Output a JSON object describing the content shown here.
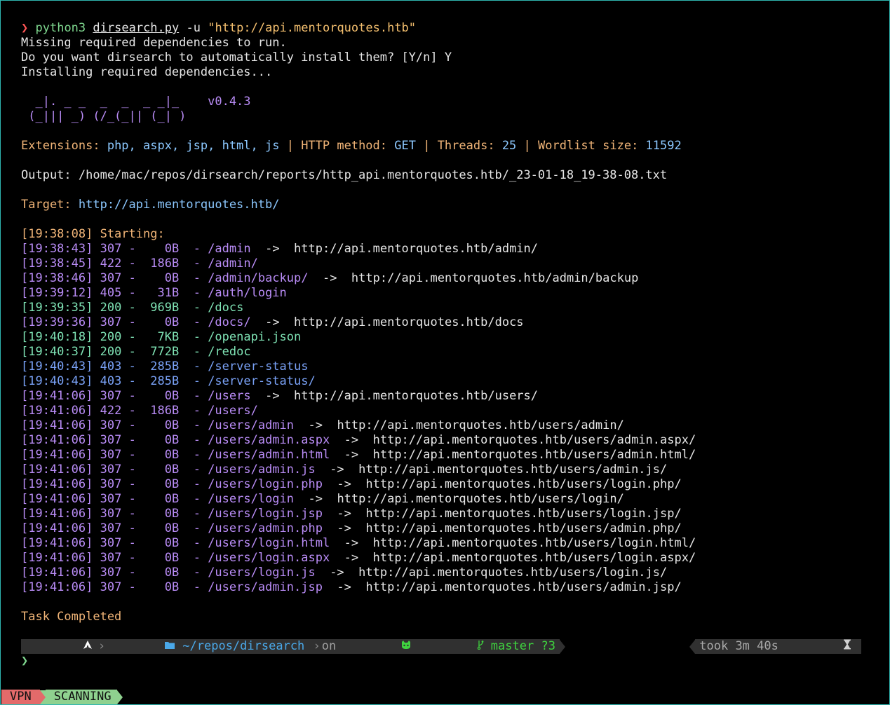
{
  "command": {
    "prompt_symbol": "❯",
    "program": "python3",
    "script": "dirsearch.py",
    "flag": "-u",
    "url_arg": "\"http://api.mentorquotes.htb\""
  },
  "preamble": [
    "Missing required dependencies to run.",
    "Do you want dirsearch to automatically install them? [Y/n] Y",
    "Installing required dependencies..."
  ],
  "banner": {
    "line1": "  _|. _ _  _  _  _ _|_    ",
    "version": "v0.4.3",
    "line2": " (_||| _) (/_(_|| (_| )"
  },
  "config": {
    "extensions_label": "Extensions: ",
    "extensions_value": "php, aspx, jsp, html, js",
    "sep": " | ",
    "method_label": "HTTP method: ",
    "method_value": "GET",
    "threads_label": "Threads: ",
    "threads_value": "25",
    "wordlist_label": "Wordlist size: ",
    "wordlist_value": "11592"
  },
  "output_line": "Output: /home/mac/repos/dirsearch/reports/http_api.mentorquotes.htb/_23-01-18_19-38-08.txt",
  "target": {
    "label": "Target: ",
    "url": "http://api.mentorquotes.htb/"
  },
  "starting": "[19:38:08] Starting: ",
  "results": [
    {
      "ts": "[19:38:43]",
      "code": "307",
      "size": "0B",
      "path": "/admin",
      "redirect": "http://api.mentorquotes.htb/admin/",
      "color": "purple"
    },
    {
      "ts": "[19:38:45]",
      "code": "422",
      "size": "186B",
      "path": "/admin/",
      "redirect": "",
      "color": "purple"
    },
    {
      "ts": "[19:38:46]",
      "code": "307",
      "size": "0B",
      "path": "/admin/backup/",
      "redirect": "http://api.mentorquotes.htb/admin/backup",
      "color": "purple"
    },
    {
      "ts": "[19:39:12]",
      "code": "405",
      "size": "31B",
      "path": "/auth/login",
      "redirect": "",
      "color": "purple"
    },
    {
      "ts": "[19:39:35]",
      "code": "200",
      "size": "969B",
      "path": "/docs",
      "redirect": "",
      "color": "green"
    },
    {
      "ts": "[19:39:36]",
      "code": "307",
      "size": "0B",
      "path": "/docs/",
      "redirect": "http://api.mentorquotes.htb/docs",
      "color": "purple"
    },
    {
      "ts": "[19:40:18]",
      "code": "200",
      "size": "7KB",
      "path": "/openapi.json",
      "redirect": "",
      "color": "green"
    },
    {
      "ts": "[19:40:37]",
      "code": "200",
      "size": "772B",
      "path": "/redoc",
      "redirect": "",
      "color": "green"
    },
    {
      "ts": "[19:40:43]",
      "code": "403",
      "size": "285B",
      "path": "/server-status",
      "redirect": "",
      "color": "blue"
    },
    {
      "ts": "[19:40:43]",
      "code": "403",
      "size": "285B",
      "path": "/server-status/",
      "redirect": "",
      "color": "blue"
    },
    {
      "ts": "[19:41:06]",
      "code": "307",
      "size": "0B",
      "path": "/users",
      "redirect": "http://api.mentorquotes.htb/users/",
      "color": "purple"
    },
    {
      "ts": "[19:41:06]",
      "code": "422",
      "size": "186B",
      "path": "/users/",
      "redirect": "",
      "color": "purple"
    },
    {
      "ts": "[19:41:06]",
      "code": "307",
      "size": "0B",
      "path": "/users/admin",
      "redirect": "http://api.mentorquotes.htb/users/admin/",
      "color": "purple"
    },
    {
      "ts": "[19:41:06]",
      "code": "307",
      "size": "0B",
      "path": "/users/admin.aspx",
      "redirect": "http://api.mentorquotes.htb/users/admin.aspx/",
      "color": "purple"
    },
    {
      "ts": "[19:41:06]",
      "code": "307",
      "size": "0B",
      "path": "/users/admin.html",
      "redirect": "http://api.mentorquotes.htb/users/admin.html/",
      "color": "purple"
    },
    {
      "ts": "[19:41:06]",
      "code": "307",
      "size": "0B",
      "path": "/users/admin.js",
      "redirect": "http://api.mentorquotes.htb/users/admin.js/",
      "color": "purple"
    },
    {
      "ts": "[19:41:06]",
      "code": "307",
      "size": "0B",
      "path": "/users/login.php",
      "redirect": "http://api.mentorquotes.htb/users/login.php/",
      "color": "purple"
    },
    {
      "ts": "[19:41:06]",
      "code": "307",
      "size": "0B",
      "path": "/users/login",
      "redirect": "http://api.mentorquotes.htb/users/login/",
      "color": "purple"
    },
    {
      "ts": "[19:41:06]",
      "code": "307",
      "size": "0B",
      "path": "/users/login.jsp",
      "redirect": "http://api.mentorquotes.htb/users/login.jsp/",
      "color": "purple"
    },
    {
      "ts": "[19:41:06]",
      "code": "307",
      "size": "0B",
      "path": "/users/admin.php",
      "redirect": "http://api.mentorquotes.htb/users/admin.php/",
      "color": "purple"
    },
    {
      "ts": "[19:41:06]",
      "code": "307",
      "size": "0B",
      "path": "/users/login.html",
      "redirect": "http://api.mentorquotes.htb/users/login.html/",
      "color": "purple"
    },
    {
      "ts": "[19:41:06]",
      "code": "307",
      "size": "0B",
      "path": "/users/login.aspx",
      "redirect": "http://api.mentorquotes.htb/users/login.aspx/",
      "color": "purple"
    },
    {
      "ts": "[19:41:06]",
      "code": "307",
      "size": "0B",
      "path": "/users/login.js",
      "redirect": "http://api.mentorquotes.htb/users/login.js/",
      "color": "purple"
    },
    {
      "ts": "[19:41:06]",
      "code": "307",
      "size": "0B",
      "path": "/users/admin.jsp",
      "redirect": "http://api.mentorquotes.htb/users/admin.jsp/",
      "color": "purple"
    }
  ],
  "task_completed": "Task Completed",
  "prompt_bar": {
    "os_icon": "arch-linux-icon",
    "folder_icon": "folder-icon",
    "path_prefix": "~/repos/",
    "path_dir": "dirsearch",
    "on": "on",
    "git_icon": "github-icon",
    "branch_icon": "git-branch-icon",
    "branch": "master",
    "untracked": "?3",
    "took": "took 3m 40s",
    "timer_icon": "hourglass-icon"
  },
  "cursor_prompt": "❯",
  "tmux": {
    "left": "VPN",
    "right": "SCANNING"
  },
  "colors": {
    "background": "#000000",
    "border": "#2fb6b0",
    "purple": "#b98cf6",
    "green": "#7fe3b5",
    "blue": "#7aa2f7",
    "orange": "#f0b477",
    "link_blue": "#8cc8ff",
    "vpn_red": "#e36a6a",
    "scanning_green": "#8fd18f"
  }
}
